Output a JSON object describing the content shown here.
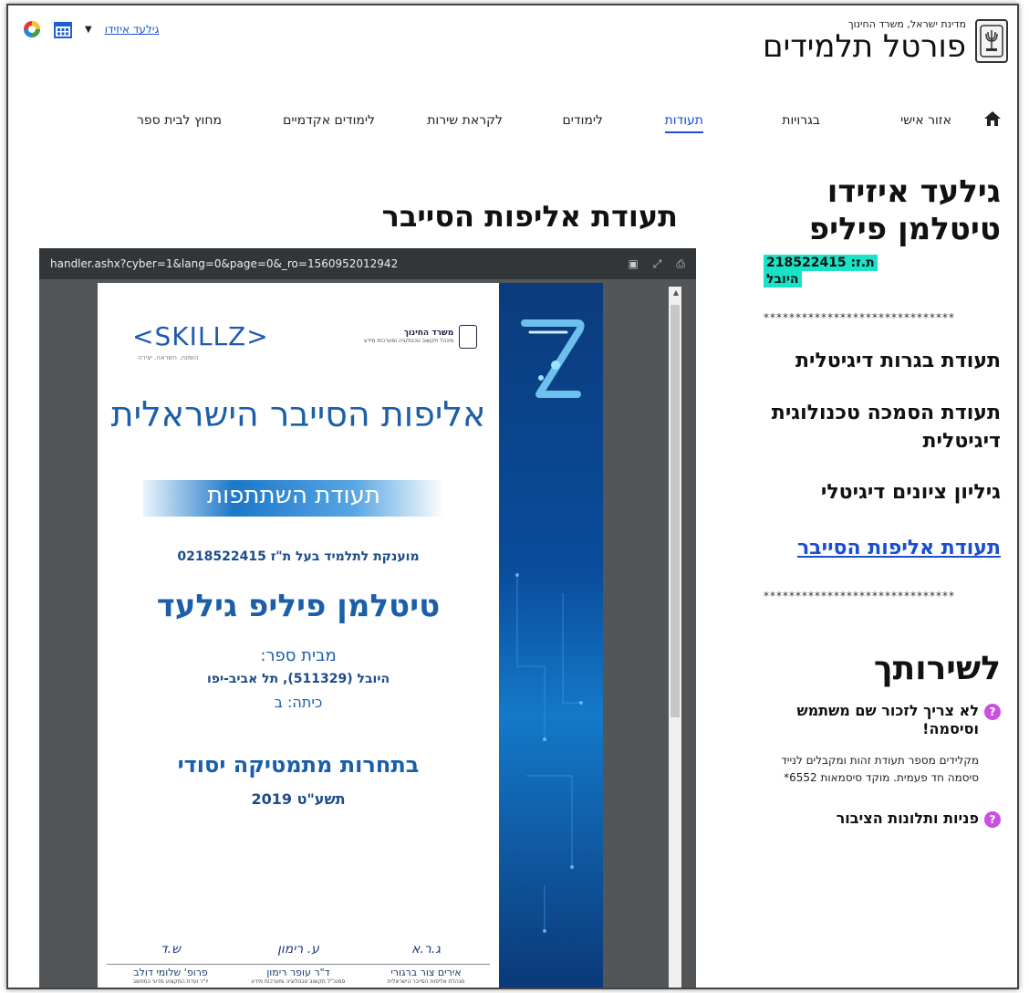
{
  "header": {
    "ministry": "מדינת ישראל, משרד החינוך",
    "portal_title": "פורטל תלמידים",
    "user_menu_label": "גילעד איזידו",
    "icons": [
      "color-wheel-icon",
      "calendar-icon",
      "chevron-down-icon",
      "home-icon",
      "state-emblem-icon"
    ]
  },
  "nav": {
    "items": [
      {
        "label": "אזור אישי",
        "active": false
      },
      {
        "label": "בגרויות",
        "active": false
      },
      {
        "label": "תעודות",
        "active": true
      },
      {
        "label": "לימודים",
        "active": false
      },
      {
        "label": "לקראת שירות",
        "active": false
      },
      {
        "label": "לימודים אקדמיים",
        "active": false
      },
      {
        "label": "מחוץ לבית ספר",
        "active": false
      }
    ]
  },
  "sidebar": {
    "student_name": "גילעד איזידו טיטלמן פיליפ",
    "id_line": "ת.ז: 218522415",
    "school": "היובל",
    "divider": "******************************",
    "links": [
      {
        "label": "תעודת בגרות דיגיטלית",
        "active": false
      },
      {
        "label": "תעודת הסמכה טכנולוגית דיגיטלית",
        "active": false
      },
      {
        "label": "גיליון ציונים דיגיטלי",
        "active": false
      },
      {
        "label": "תעודת אליפות הסייבר",
        "active": true
      }
    ],
    "service_title": "לשירותך",
    "faq": [
      {
        "question": "לא צריך לזכור שם משתמש וסיסמה!",
        "answer": "מקלידים מספר תעודת זהות ומקבלים לנייד סיסמה חד פעמית. מוקד סיסמאות 6552*"
      },
      {
        "question": "פניות ותלונות הציבור",
        "answer": ""
      }
    ]
  },
  "main": {
    "title": "תעודת אליפות הסייבר",
    "viewer_url": "handler.ashx?cyber=1&lang=0&page=0&_ro=1560952012942"
  },
  "certificate": {
    "skillz_logo": "<SKILLZ>",
    "skillz_tagline": "הזמנה. השראה. יצירה",
    "moe_name": "משרד החינוך",
    "moe_sub": "מינהל תקשוב טכנולוגיה ומערכות מידע",
    "title": "אליפות הסייבר הישראלית",
    "ribbon": "תעודת השתתפות",
    "awarded_to": "מוענקת לתלמיד בעל ת\"ז 0218522415",
    "student": "טיטלמן פיליפ גילעד",
    "from_school_label": "מבית ספר:",
    "school_line": "היובל (511329), תל אביב-יפו",
    "class_line": "כיתה: ב",
    "competition": "בתחרות מתמטיקה יסודי",
    "year": "תשע\"ט 2019",
    "signatures": [
      {
        "name": "אירים צור ברגורי",
        "role": "מנהלת אליפות הסייבר הישראלית",
        "scribble": "ג.ר.א"
      },
      {
        "name": "ד\"ר עופר רימון",
        "role": "סמנכ\"ל תקשוב טכנולוגיה ומערכות מידע",
        "scribble": "ע. רימון"
      },
      {
        "name": "פרופ' שלומי דולב",
        "role": "יו\"ר ועדת המקצוע מדעי המחשב",
        "scribble": "ש.ד"
      }
    ]
  },
  "colors": {
    "accent_link": "#1a4fd1",
    "highlight": "#19e3c7",
    "faq_badge": "#c94fe0",
    "certificate_blue": "#1b5fa9"
  }
}
